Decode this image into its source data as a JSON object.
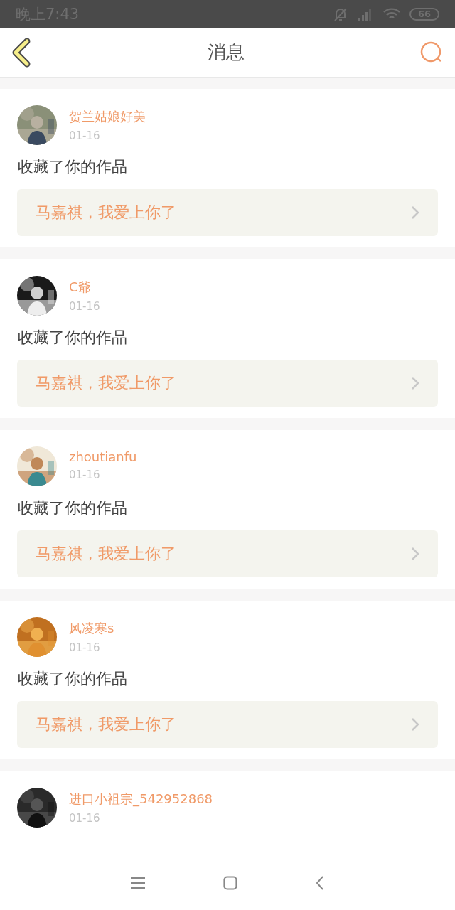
{
  "status_bar": {
    "time": "晚上7:43",
    "battery": "66"
  },
  "header": {
    "title": "消息"
  },
  "messages": [
    {
      "user": "贺兰姑娘好美",
      "date": "01-16",
      "action": "收藏了你的作品",
      "work": "马嘉祺，我爱上你了"
    },
    {
      "user": "C爺",
      "date": "01-16",
      "action": "收藏了你的作品",
      "work": "马嘉祺，我爱上你了"
    },
    {
      "user": "zhoutianfu",
      "date": "01-16",
      "action": "收藏了你的作品",
      "work": "马嘉祺，我爱上你了"
    },
    {
      "user": "风凌寒s",
      "date": "01-16",
      "action": "收藏了你的作品",
      "work": "马嘉祺，我爱上你了"
    },
    {
      "user": "进口小祖宗_542952868",
      "date": "01-16"
    }
  ]
}
